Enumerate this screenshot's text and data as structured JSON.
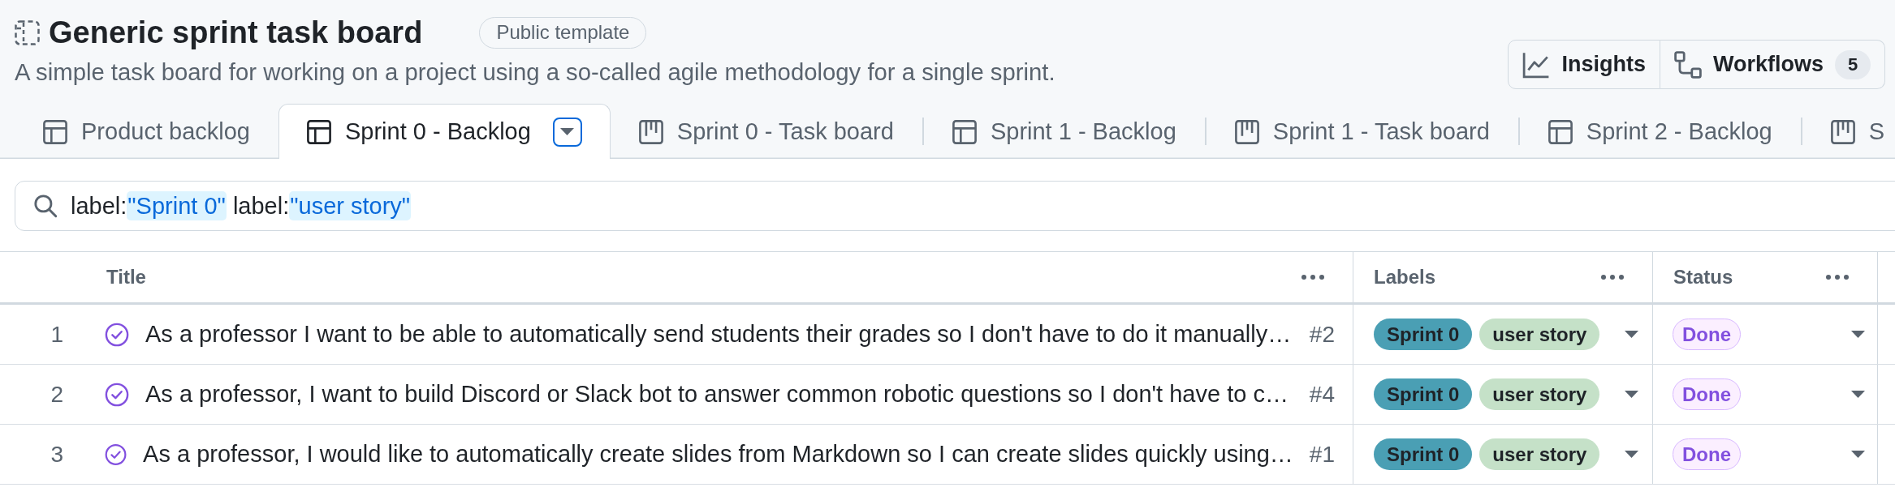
{
  "project": {
    "title": "Generic sprint task board",
    "badge": "Public template",
    "description": "A simple task board for working on a project using a so-called agile methodology for a single sprint."
  },
  "actions": [
    {
      "kind": "insights",
      "label": "Insights"
    },
    {
      "kind": "workflows",
      "label": "Workflows",
      "count": "5"
    }
  ],
  "views": [
    {
      "kind": "table",
      "label": "Product backlog",
      "selected": false
    },
    {
      "kind": "table",
      "label": "Sprint 0 - Backlog",
      "selected": true
    },
    {
      "kind": "board",
      "label": "Sprint 0 - Task board",
      "selected": false
    },
    {
      "kind": "table",
      "label": "Sprint 1 - Backlog",
      "selected": false
    },
    {
      "kind": "board",
      "label": "Sprint 1 - Task board",
      "selected": false
    },
    {
      "kind": "table",
      "label": "Sprint 2 - Backlog",
      "selected": false
    },
    {
      "kind": "board",
      "label": "S",
      "selected": false
    }
  ],
  "filter": {
    "tokens": [
      {
        "key": "label:",
        "value": "\"Sprint 0\""
      },
      {
        "key": "label:",
        "value": "\"user story\""
      }
    ]
  },
  "table": {
    "columns": [
      "Title",
      "Labels",
      "Status"
    ],
    "rows": [
      {
        "number": "1",
        "closed": true,
        "title": "As a professor I want to be able to automatically send students their grades so I don't have to do it manually…",
        "issue": "#2",
        "labels": [
          {
            "text": "Sprint 0",
            "color": "#4a9fb4"
          },
          {
            "text": "user story",
            "color": "#c5e1c8"
          }
        ],
        "status": "Done"
      },
      {
        "number": "2",
        "closed": true,
        "title": "As a professor, I want to build Discord or Slack bot to answer common robotic questions so I don't have to c…",
        "issue": "#4",
        "labels": [
          {
            "text": "Sprint 0",
            "color": "#4a9fb4"
          },
          {
            "text": "user story",
            "color": "#c5e1c8"
          }
        ],
        "status": "Done"
      },
      {
        "number": "3",
        "closed": true,
        "title": "As a professor, I would like to automatically create slides from Markdown so I can create slides quickly using…",
        "issue": "#1",
        "labels": [
          {
            "text": "Sprint 0",
            "color": "#4a9fb4"
          },
          {
            "text": "user story",
            "color": "#c5e1c8"
          }
        ],
        "status": "Done"
      }
    ]
  }
}
